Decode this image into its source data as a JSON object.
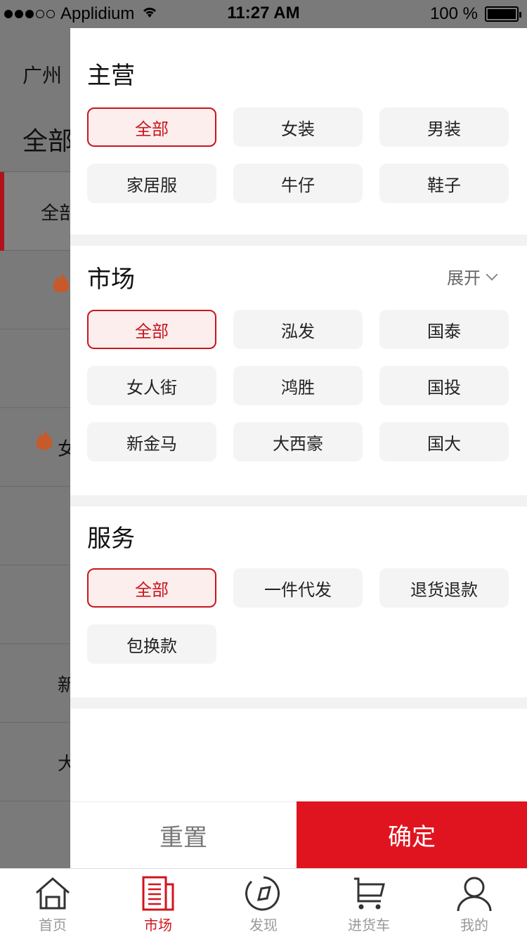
{
  "status_bar": {
    "carrier": "Applidium",
    "time": "11:27 AM",
    "battery": "100 %"
  },
  "background": {
    "city": "广州",
    "tab_all": "全部",
    "rows": [
      "全部",
      "",
      "",
      "女",
      "",
      "",
      "新",
      "大"
    ]
  },
  "filter": {
    "main_business": {
      "title": "主营",
      "options": [
        "全部",
        "女装",
        "男装",
        "家居服",
        "牛仔",
        "鞋子"
      ],
      "selected": "全部"
    },
    "market": {
      "title": "市场",
      "expand_label": "展开",
      "options": [
        "全部",
        "泓发",
        "国泰",
        "女人街",
        "鸿胜",
        "国投",
        "新金马",
        "大西豪",
        "国大"
      ],
      "selected": "全部"
    },
    "service": {
      "title": "服务",
      "options": [
        "全部",
        "一件代发",
        "退货退款",
        "包换款"
      ],
      "selected": "全部"
    },
    "reset_label": "重置",
    "confirm_label": "确定"
  },
  "tab_bar": {
    "items": [
      {
        "label": "首页",
        "icon": "home-icon"
      },
      {
        "label": "市场",
        "icon": "market-icon"
      },
      {
        "label": "发现",
        "icon": "compass-icon"
      },
      {
        "label": "进货车",
        "icon": "cart-icon"
      },
      {
        "label": "我的",
        "icon": "user-icon"
      }
    ],
    "active": "市场"
  },
  "colors": {
    "accent": "#e0141f",
    "active_chip_bg": "#fdeeee",
    "chip_bg": "#f4f4f4"
  }
}
